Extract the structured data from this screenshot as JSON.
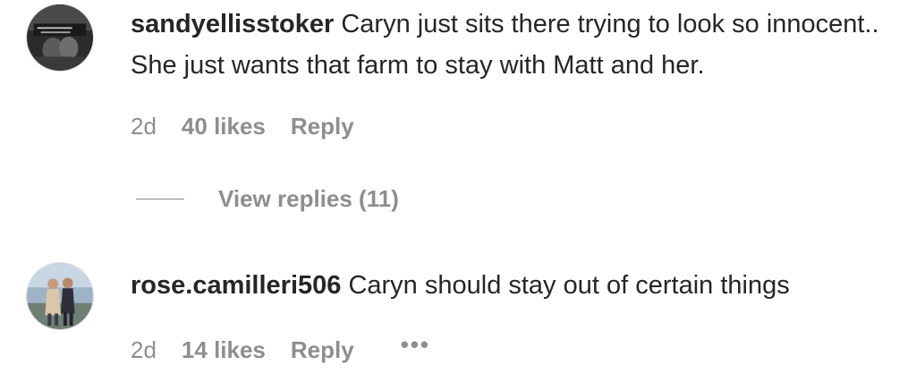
{
  "comments": [
    {
      "username": "sandyellisstoker",
      "text": " Caryn just sits there trying to look so innocent.. She just wants that farm to stay with Matt and her.",
      "time": "2d",
      "likes": "40 likes",
      "reply_label": "Reply",
      "avatar_icon": "profile-photo-dark"
    },
    {
      "username": "rose.camilleri506",
      "text": " Caryn should stay out of certain things",
      "time": "2d",
      "likes": "14 likes",
      "reply_label": "Reply",
      "more_label": "•••",
      "avatar_icon": "profile-photo-two-people"
    }
  ],
  "view_replies": {
    "label": "View replies (11)"
  },
  "colors": {
    "text": "#262626",
    "muted": "#8e8e8e"
  }
}
